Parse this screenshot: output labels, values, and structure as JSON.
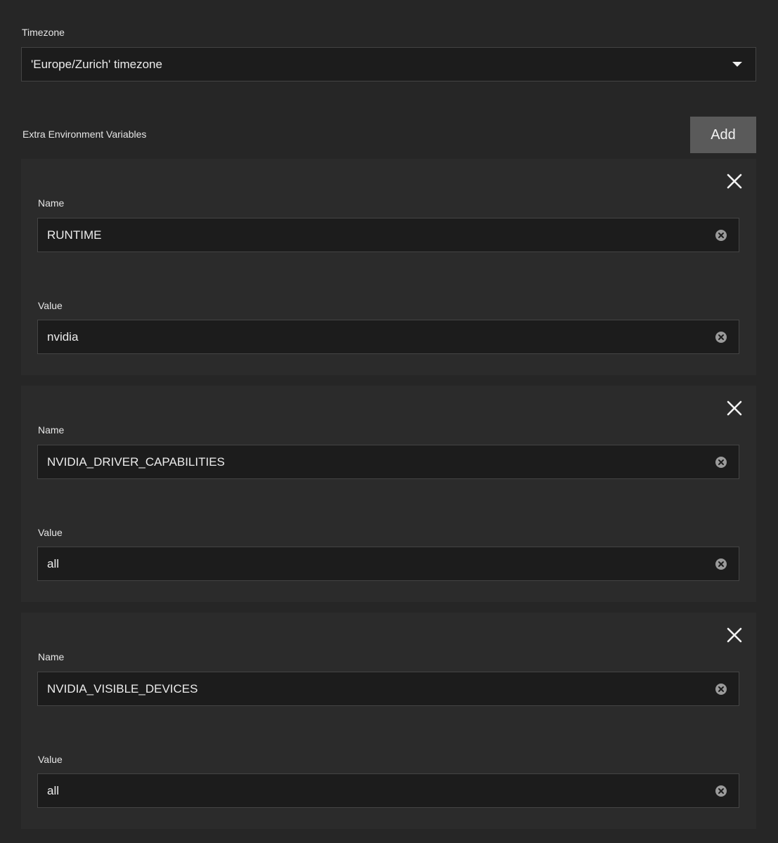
{
  "timezone": {
    "label": "Timezone",
    "selected": "'Europe/Zurich' timezone"
  },
  "env": {
    "label": "Extra Environment Variables",
    "add_label": "Add",
    "items": [
      {
        "name_label": "Name",
        "name": "RUNTIME",
        "value_label": "Value",
        "value": "nvidia"
      },
      {
        "name_label": "Name",
        "name": "NVIDIA_DRIVER_CAPABILITIES",
        "value_label": "Value",
        "value": "all"
      },
      {
        "name_label": "Name",
        "name": "NVIDIA_VISIBLE_DEVICES",
        "value_label": "Value",
        "value": "all"
      }
    ]
  },
  "icons": {
    "dropdown": "chevron-down-icon",
    "remove": "close-icon",
    "clear": "clear-circle-icon"
  }
}
